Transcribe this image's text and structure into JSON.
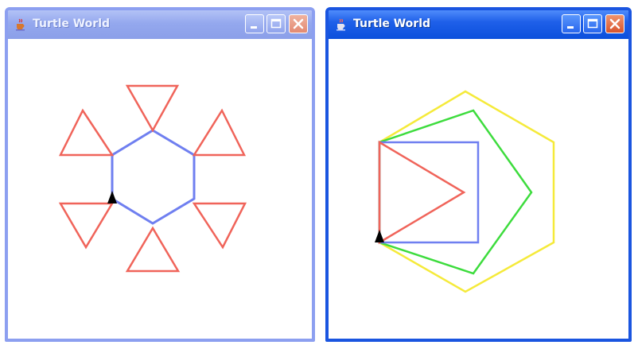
{
  "windows": [
    {
      "title": "Turtle World",
      "state": "inactive",
      "drawing": "hexagon with a red triangle on each of its six sides",
      "colors": {
        "shape": "#6f7ff0",
        "accent": "#f0645a",
        "turtle": "#000000"
      }
    },
    {
      "title": "Turtle World",
      "state": "active",
      "drawing": "nested triangle, square, pentagon and hexagon from a shared vertex",
      "colors": {
        "triangle": "#f0645a",
        "square": "#6f7ff0",
        "pentagon": "#3ddc3d",
        "hexagon": "#f5ea3a",
        "turtle": "#000000"
      }
    }
  ],
  "controls": {
    "minimize_icon": "minimize-icon",
    "maximize_icon": "maximize-icon",
    "close_icon": "close-icon",
    "app_icon": "java-cup-icon",
    "turtle_icon": "turtle-arrow-icon"
  }
}
